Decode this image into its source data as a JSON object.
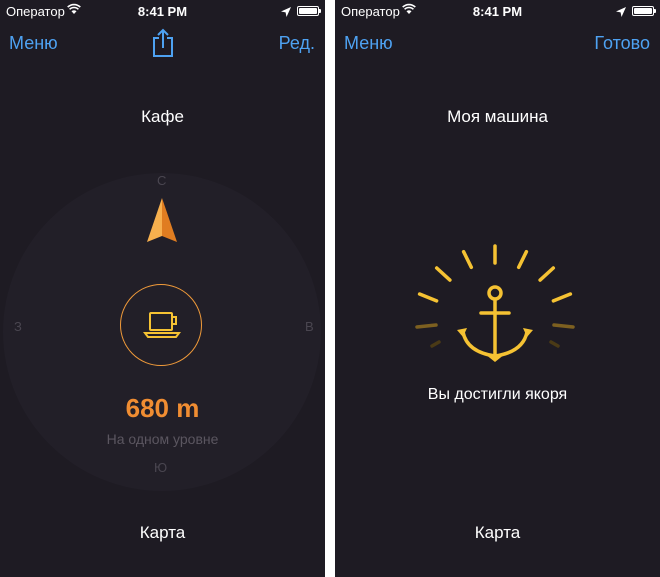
{
  "screens": [
    {
      "status": {
        "carrier": "Оператор",
        "time": "8:41 PM"
      },
      "nav": {
        "left": "Меню",
        "right": "Ред."
      },
      "title": "Кафе",
      "compass": {
        "north": "С",
        "west": "З",
        "east": "В",
        "south": "Ю"
      },
      "distance": "680 m",
      "level": "На одном уровне",
      "bottom": "Карта",
      "icons": [
        "wifi-icon",
        "location-icon",
        "battery-icon",
        "share-icon",
        "direction-arrow-icon",
        "coffee-cup-icon"
      ]
    },
    {
      "status": {
        "carrier": "Оператор",
        "time": "8:41 PM"
      },
      "nav": {
        "left": "Меню",
        "right": "Готово"
      },
      "title": "Моя машина",
      "message": "Вы достигли якоря",
      "bottom": "Карта",
      "icons": [
        "wifi-icon",
        "location-icon",
        "battery-icon",
        "anchor-icon"
      ]
    }
  ],
  "colors": {
    "background": "#1e1b23",
    "accent_blue": "#4ea2f2",
    "accent_orange": "#f08d32",
    "anchor_yellow": "#f5c233"
  }
}
